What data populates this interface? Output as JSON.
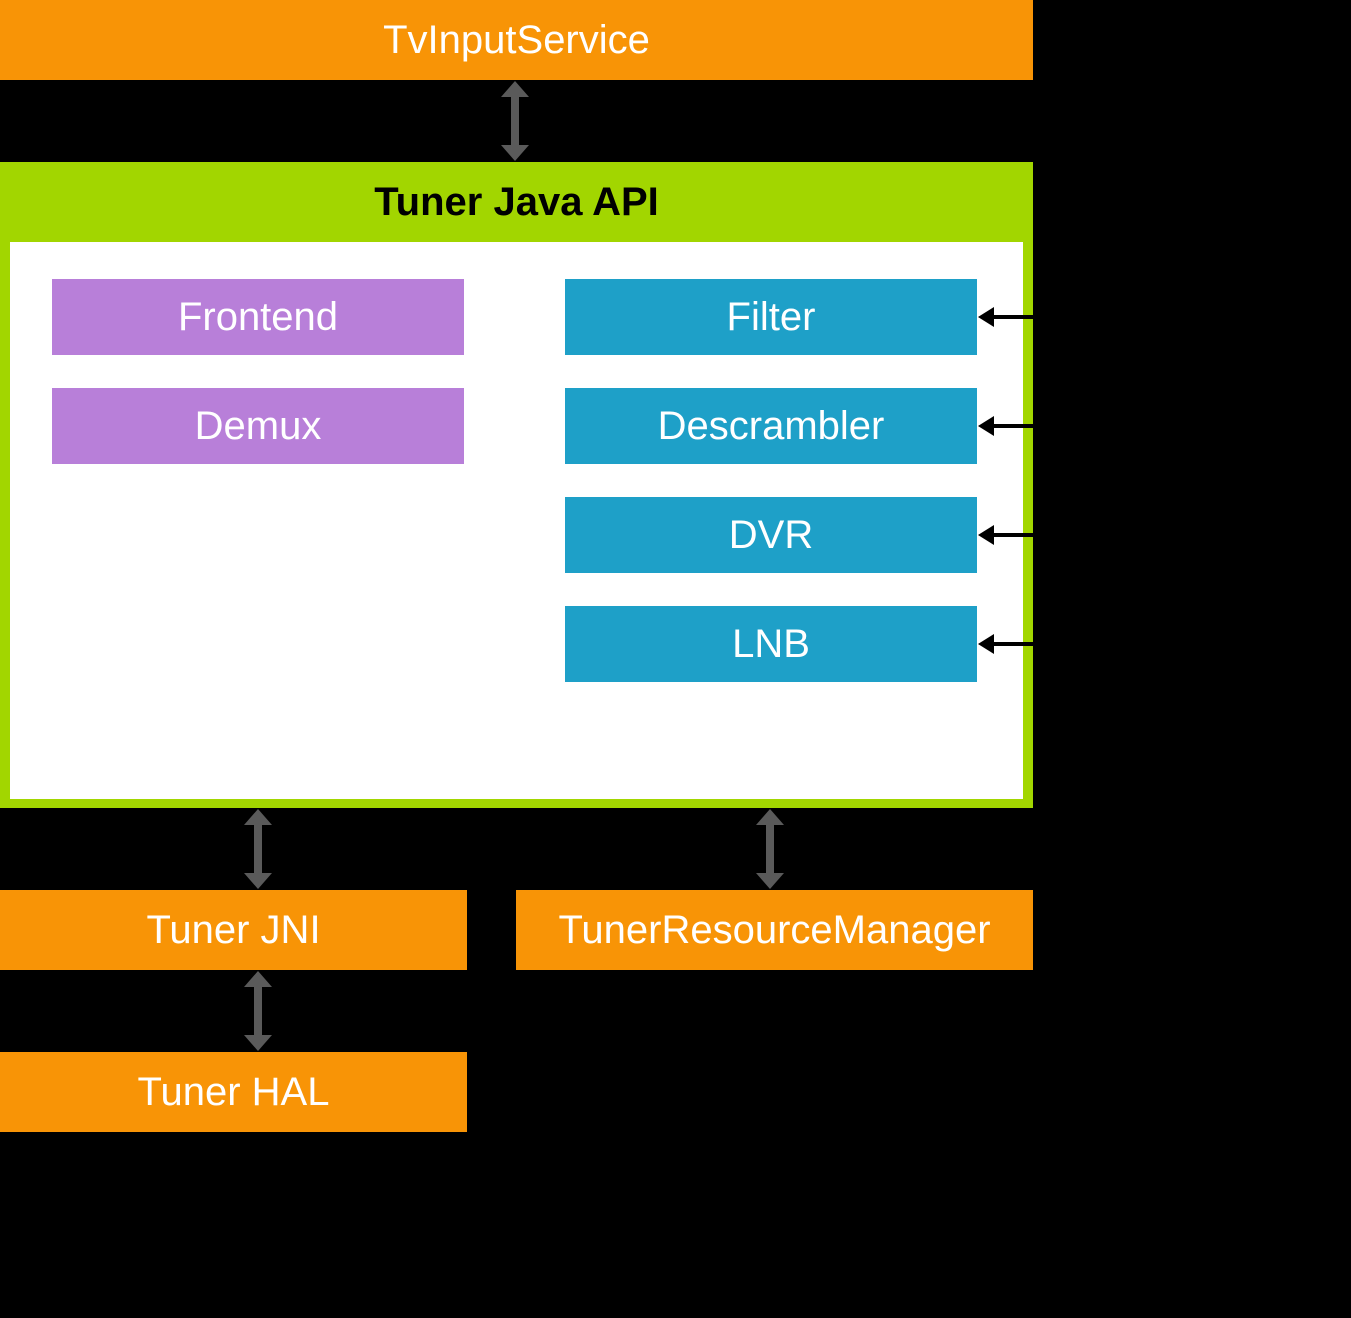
{
  "blocks": {
    "tv_input_service": "TvInputService",
    "tuner_java_api": "Tuner Java API",
    "frontend": "Frontend",
    "demux": "Demux",
    "filter": "Filter",
    "descrambler": "Descrambler",
    "dvr": "DVR",
    "lnb": "LNB",
    "tuner_jni": "Tuner JNI",
    "tuner_resource_manager": "TunerResourceManager",
    "tuner_hal": "Tuner HAL"
  },
  "colors": {
    "orange": "#f89406",
    "yellow_green": "#a2d600",
    "purple": "#b87fd9",
    "teal": "#1ea0c8"
  }
}
